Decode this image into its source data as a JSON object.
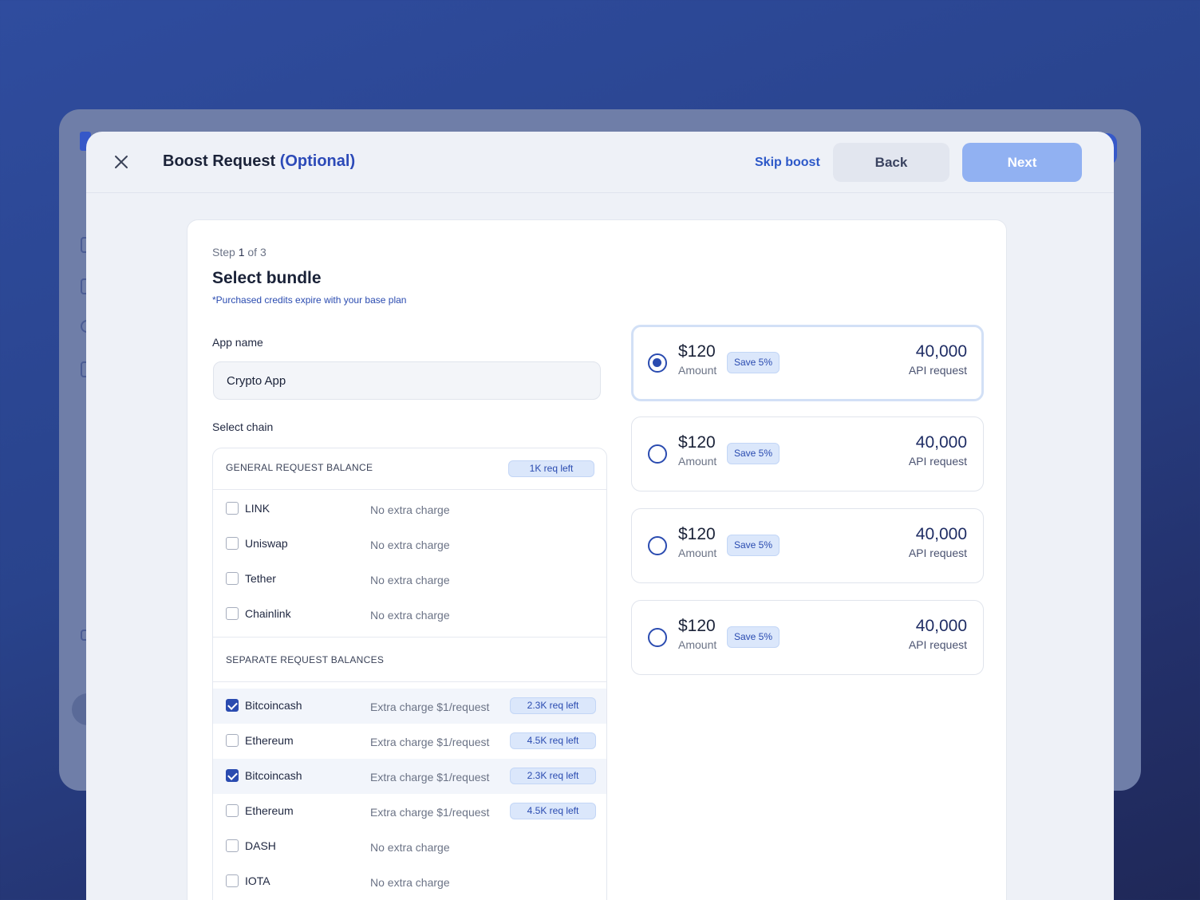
{
  "modal": {
    "title": "Boost Request",
    "title_suffix": "(Optional)",
    "skip_label": "Skip boost",
    "back_label": "Back",
    "next_label": "Next"
  },
  "step": {
    "prefix": "Step",
    "current": "1",
    "suffix": "of 3",
    "title": "Select bundle",
    "note": "*Purchased credits expire with your base plan"
  },
  "form": {
    "app_name_label": "App name",
    "app_name_value": "Crypto App",
    "select_chain_label": "Select chain"
  },
  "chains": {
    "general_label": "GENERAL REQUEST BALANCE",
    "general_badge": "1K req left",
    "general": [
      {
        "name": "LINK",
        "charge": "No extra charge",
        "checked": false
      },
      {
        "name": "Uniswap",
        "charge": "No extra charge",
        "checked": false
      },
      {
        "name": "Tether",
        "charge": "No extra charge",
        "checked": false
      },
      {
        "name": "Chainlink",
        "charge": "No extra charge",
        "checked": false
      }
    ],
    "separate_label": "SEPARATE REQUEST BALANCES",
    "separate": [
      {
        "name": "Bitcoincash",
        "charge": "Extra charge $1/request",
        "badge": "2.3K req left",
        "checked": true
      },
      {
        "name": "Ethereum",
        "charge": "Extra charge $1/request",
        "badge": "4.5K req left",
        "checked": false
      },
      {
        "name": "Bitcoincash",
        "charge": "Extra charge $1/request",
        "badge": "2.3K req left",
        "checked": true
      },
      {
        "name": "Ethereum",
        "charge": "Extra charge $1/request",
        "badge": "4.5K req left",
        "checked": false
      },
      {
        "name": "DASH",
        "charge": "No extra charge",
        "badge": "",
        "checked": false
      },
      {
        "name": "IOTA",
        "charge": "No extra charge",
        "badge": "",
        "checked": false
      }
    ]
  },
  "bundles": [
    {
      "price": "$120",
      "amount_label": "Amount",
      "save": "Save 5%",
      "count": "40,000",
      "count_label": "API request",
      "selected": true
    },
    {
      "price": "$120",
      "amount_label": "Amount",
      "save": "Save 5%",
      "count": "40,000",
      "count_label": "API request",
      "selected": false
    },
    {
      "price": "$120",
      "amount_label": "Amount",
      "save": "Save 5%",
      "count": "40,000",
      "count_label": "API request",
      "selected": false
    },
    {
      "price": "$120",
      "amount_label": "Amount",
      "save": "Save 5%",
      "count": "40,000",
      "count_label": "API request",
      "selected": false
    }
  ],
  "colors": {
    "accent": "#2a4bb0",
    "next_button": "#91b1f2",
    "badge_bg": "#dbe7fb"
  }
}
